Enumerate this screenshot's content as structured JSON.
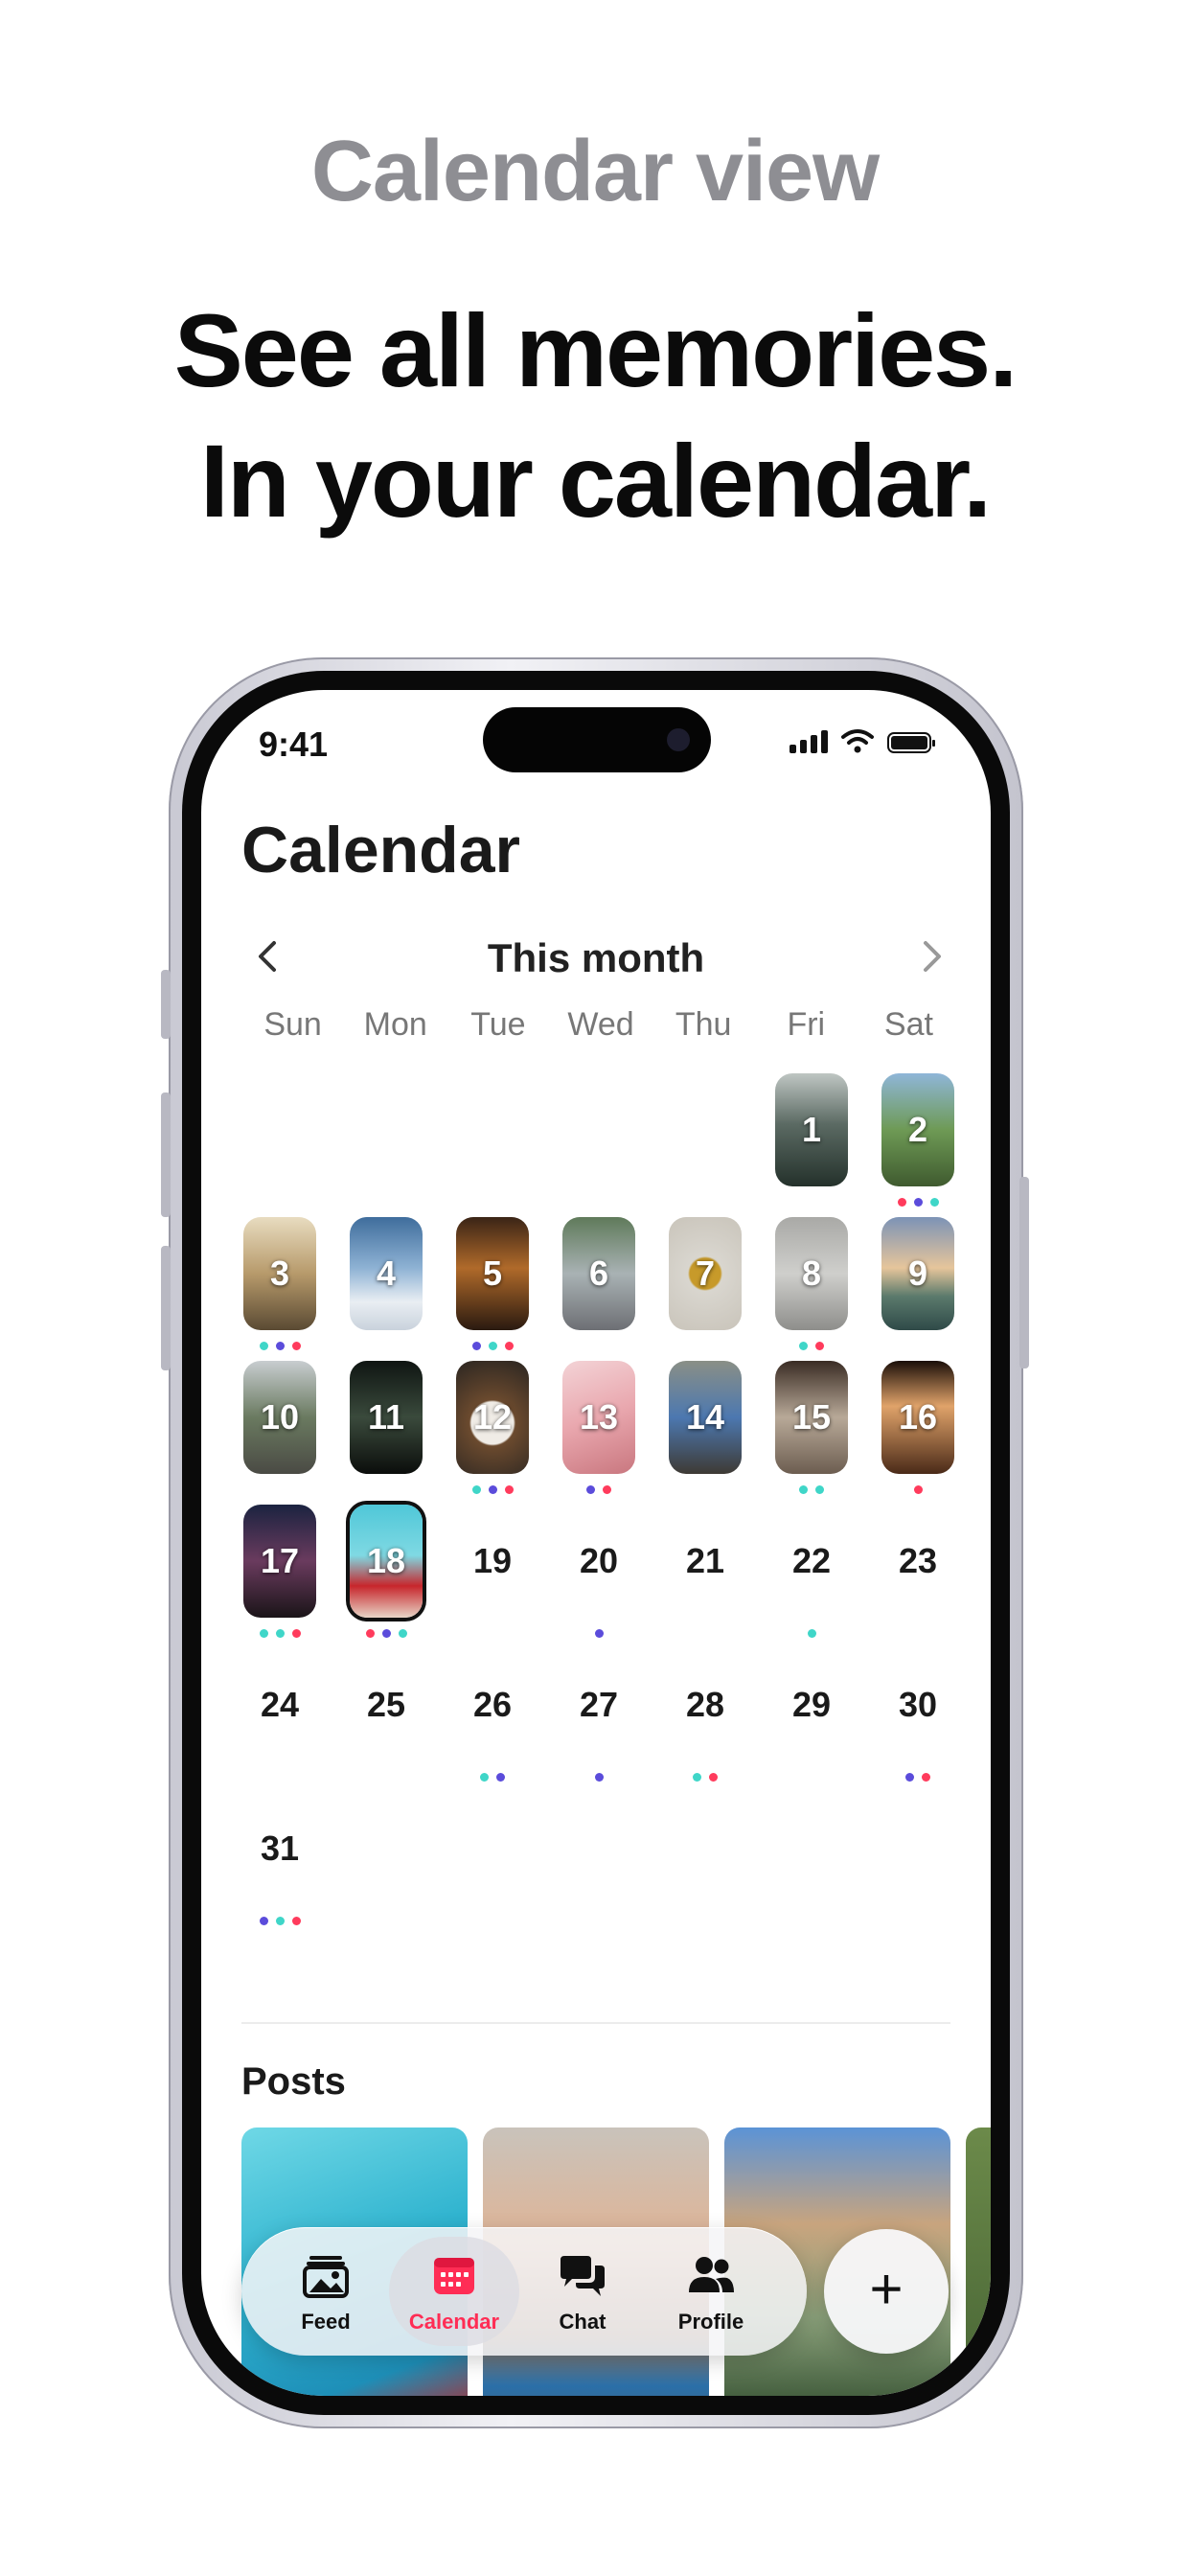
{
  "hero": {
    "eyebrow": "Calendar view",
    "headline_line1": "See all memories.",
    "headline_line2": "In your calendar."
  },
  "status_bar": {
    "time": "9:41"
  },
  "screen": {
    "title": "Calendar"
  },
  "calendar": {
    "month_label": "This month",
    "weekdays": [
      "Sun",
      "Mon",
      "Tue",
      "Wed",
      "Thu",
      "Fri",
      "Sat"
    ],
    "days": [
      "1",
      "2",
      "3",
      "4",
      "5",
      "6",
      "7",
      "8",
      "9",
      "10",
      "11",
      "12",
      "13",
      "14",
      "15",
      "16",
      "17",
      "18",
      "19",
      "20",
      "21",
      "22",
      "23",
      "24",
      "25",
      "26",
      "27",
      "28",
      "29",
      "30",
      "31"
    ],
    "selected_day": "18"
  },
  "posts": {
    "title": "Posts"
  },
  "tabbar": {
    "feed": "Feed",
    "calendar": "Calendar",
    "chat": "Chat",
    "profile": "Profile",
    "add": "+"
  },
  "colors": {
    "accent": "#ff2d55",
    "dot_red": "#ff3b5c",
    "dot_purple": "#5b4cdb",
    "dot_teal": "#3fd6c8"
  },
  "icons": [
    "chevron-left-icon",
    "chevron-right-icon",
    "feed-icon",
    "calendar-icon",
    "chat-icon",
    "profile-icon",
    "plus-icon"
  ]
}
